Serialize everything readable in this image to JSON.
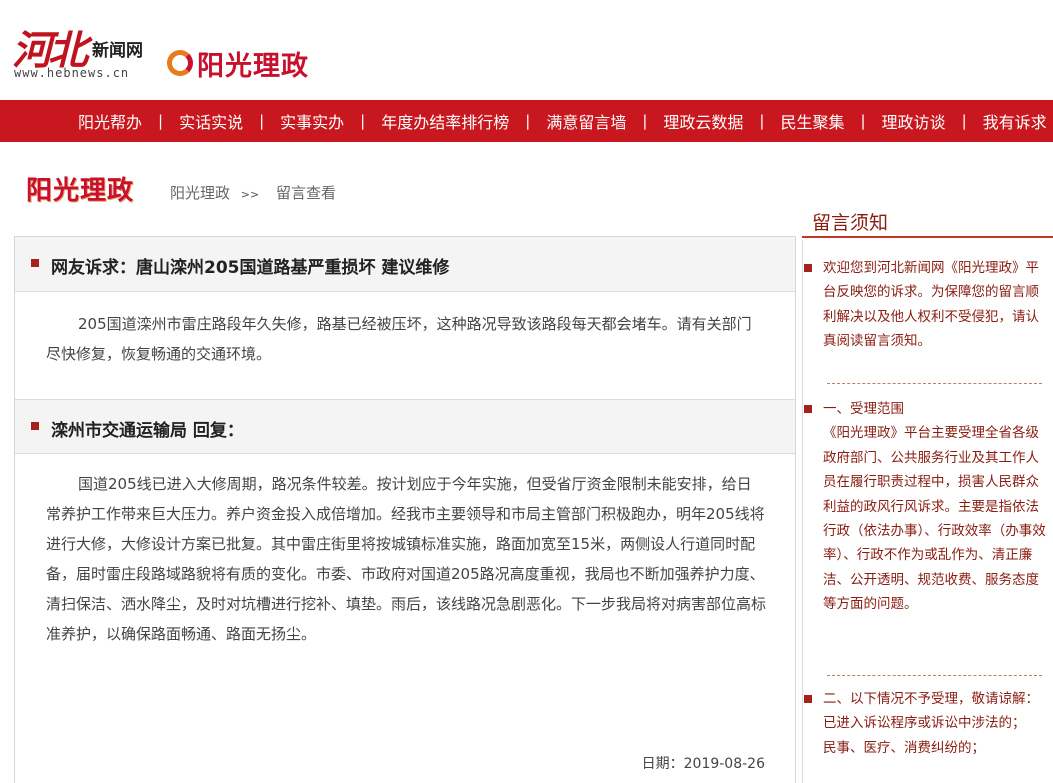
{
  "header": {
    "site_brand": "河北",
    "site_name": "新闻网",
    "site_url": "www.hebnews.cn",
    "channel_logo": "阳光理政"
  },
  "nav": {
    "items": [
      "阳光帮办",
      "实话实说",
      "实事实办",
      "年度办结率排行榜",
      "满意留言墙",
      "理政云数据",
      "民生聚集",
      "理政访谈",
      "我有诉求"
    ],
    "separator": "|"
  },
  "breadcrumb": {
    "section_title": "阳光理政",
    "home": "阳光理政",
    "arrow": ">>",
    "current": "留言查看"
  },
  "post": {
    "title": "网友诉求：唐山滦州205国道路基严重损坏 建议维修",
    "body": "205国道滦州市雷庄路段年久失修，路基已经被压坏，这种路况导致该路段每天都会堵车。请有关部门尽快修复，恢复畅通的交通环境。"
  },
  "reply": {
    "title": "滦州市交通运输局 回复：",
    "body": "国道205线已进入大修周期，路况条件较差。按计划应于今年实施，但受省厅资金限制未能安排，给日常养护工作带来巨大压力。养户资金投入成倍增加。经我市主要领导和市局主管部门积极跑办，明年205线将进行大修，大修设计方案已批复。其中雷庄街里将按城镇标准实施，路面加宽至15米，两侧设人行道同时配备，届时雷庄段路域路貌将有质的变化。市委、市政府对国道205路况高度重视，我局也不断加强养护力度、清扫保洁、洒水降尘，及时对坑槽进行挖补、填垫。雨后，该线路况急剧恶化。下一步我局将对病害部位高标准养护，以确保路面畅通、路面无扬尘。",
    "date": "日期：2019-08-26"
  },
  "sidebar": {
    "title": "留言须知",
    "notes": [
      "欢迎您到河北新闻网《阳光理政》平台反映您的诉求。为保障您的留言顺利解决以及他人权利不受侵犯，请认真阅读留言须知。",
      "一、受理范围\n《阳光理政》平台主要受理全省各级政府部门、公共服务行业及其工作人员在履行职责过程中，损害人民群众利益的政风行风诉求。主要是指依法行政（依法办事）、行政效率（办事效率）、行政不作为或乱作为、清正廉洁、公开透明、规范收费、服务态度等方面的问题。",
      "二、以下情况不予受理，敬请谅解：\n已进入诉讼程序或诉讼中涉法的；\n民事、医疗、消费纠纷的；"
    ]
  },
  "colors": {
    "nav_bg": "#c8171e",
    "brand_red": "#c8102e",
    "bullet": "#a5221c",
    "sidebar_text": "#8a1c12"
  }
}
